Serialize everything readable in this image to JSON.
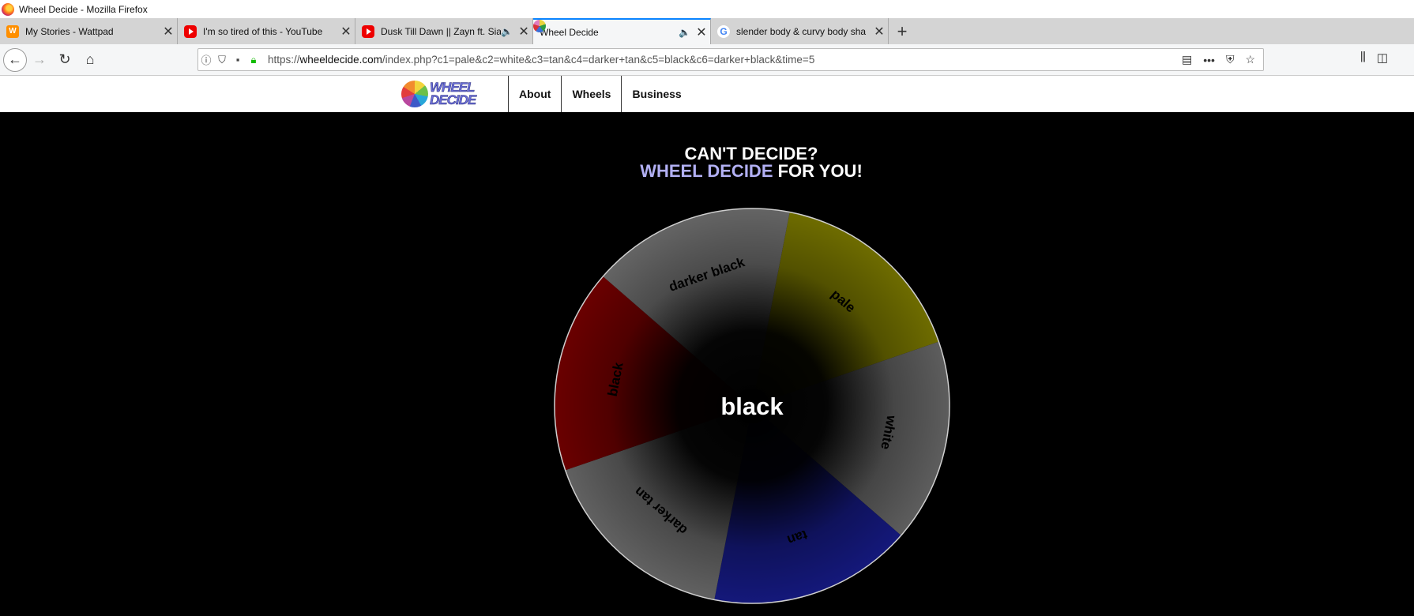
{
  "window": {
    "title": "Wheel Decide - Mozilla Firefox"
  },
  "tabs": [
    {
      "label": "My Stories - Wattpad",
      "favicon": "wattpad-icon",
      "audio": false,
      "active": false
    },
    {
      "label": "I'm so tired of this - YouTube",
      "favicon": "youtube-icon",
      "audio": false,
      "active": false
    },
    {
      "label": "Dusk Till Dawn || Zayn ft. Sia",
      "favicon": "youtube-icon",
      "audio": true,
      "active": false
    },
    {
      "label": "Wheel Decide",
      "favicon": "wheel-decide-icon",
      "audio": true,
      "active": true
    },
    {
      "label": "slender body & curvy body sha",
      "favicon": "google-icon",
      "audio": false,
      "active": false
    }
  ],
  "urlbar": {
    "scheme": "https://",
    "host": "wheeldecide.com",
    "path": "/index.php?c1=pale&c2=white&c3=tan&c4=darker+tan&c5=black&c6=darker+black&time=5"
  },
  "site": {
    "logo_line1": "WHEEL",
    "logo_line2": "DECIDE",
    "menu": [
      "About",
      "Wheels",
      "Business"
    ]
  },
  "headline": {
    "line1": "CAN'T DECIDE?",
    "accent": "WHEEL DECIDE",
    "rest": " FOR YOU!"
  },
  "wheel": {
    "result": "black",
    "segments": [
      {
        "label": "pale",
        "color": "#6e6c00"
      },
      {
        "label": "white",
        "color": "#5d5d5d"
      },
      {
        "label": "tan",
        "color": "#14187a"
      },
      {
        "label": "darker tan",
        "color": "#616161"
      },
      {
        "label": "black",
        "color": "#6a0000"
      },
      {
        "label": "darker black",
        "color": "#646464"
      }
    ]
  }
}
